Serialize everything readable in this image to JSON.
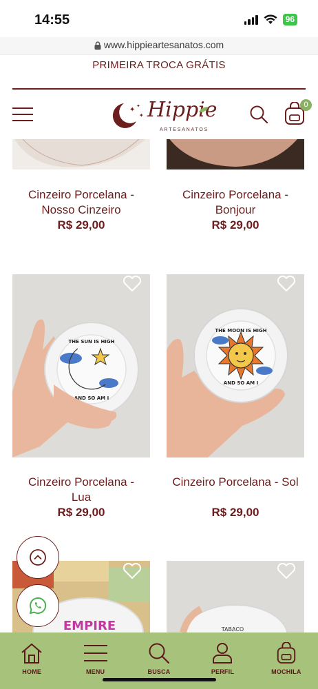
{
  "status": {
    "time": "14:55",
    "battery": "96"
  },
  "browser": {
    "url": "www.hippieartesanatos.com"
  },
  "promo": {
    "text": "PRIMEIRA TROCA GRÁTIS"
  },
  "header": {
    "logo_text": "Hippie",
    "logo_sub": "ARTESANATOS",
    "cart_count": "0"
  },
  "products": [
    {
      "title_line1": "Cinzeiro Porcelana -",
      "title_line2": "Nosso Cinzeiro",
      "price": "R$ 29,00"
    },
    {
      "title_line1": "Cinzeiro Porcelana -",
      "title_line2": "Bonjour",
      "price": "R$ 29,00"
    },
    {
      "title_line1": "Cinzeiro Porcelana -",
      "title_line2": "Lua",
      "price": "R$ 29,00",
      "ashtray_text_top": "THE SUN IS HIGH",
      "ashtray_text_bottom": "AND SO AM I"
    },
    {
      "title_line1": "Cinzeiro Porcelana - Sol",
      "title_line2": "",
      "price": "R$ 29,00",
      "ashtray_text_top": "THE MOON IS HIGH",
      "ashtray_text_bottom": "AND SO AM I"
    },
    {
      "title_line1": "",
      "title_line2": "",
      "price": "",
      "ashtray_text_top": "EMPIRE"
    },
    {
      "title_line1": "",
      "title_line2": "",
      "price": "",
      "ashtray_text_top": "TABACO"
    }
  ],
  "bottom_nav": [
    {
      "label": "HOME",
      "icon": "home-icon"
    },
    {
      "label": "MENU",
      "icon": "menu-icon"
    },
    {
      "label": "BUSCA",
      "icon": "search-icon"
    },
    {
      "label": "PERFIL",
      "icon": "user-icon"
    },
    {
      "label": "MOCHILA",
      "icon": "backpack-icon"
    }
  ],
  "colors": {
    "brand": "#6b1e1e",
    "nav_bg": "#a6c27b",
    "badge": "#8bb162"
  }
}
